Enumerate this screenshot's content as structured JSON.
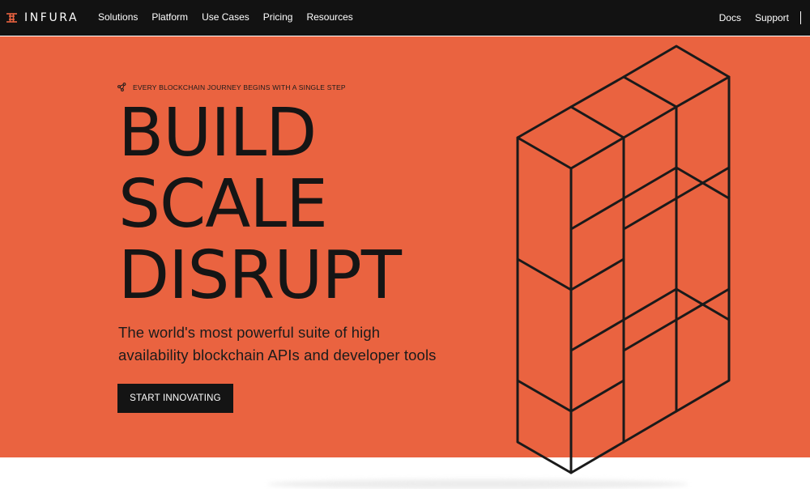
{
  "brand": {
    "name": "INFURA",
    "logo_icon": "infura-logo-icon"
  },
  "nav": {
    "links": [
      "Solutions",
      "Platform",
      "Use Cases",
      "Pricing",
      "Resources"
    ],
    "right_links": [
      "Docs",
      "Support"
    ]
  },
  "hero": {
    "tagline": "EVERY BLOCKCHAIN JOURNEY BEGINS WITH A SINGLE STEP",
    "tagline_icon": "network-nodes-icon",
    "headline": [
      "BUILD",
      "SCALE",
      "DISRUPT"
    ],
    "subtitle_line1": "The world's most powerful suite of high",
    "subtitle_line2": "availability blockchain APIs and developer tools",
    "cta_label": "START INNOVATING",
    "illustration": "isometric-cube-stack"
  },
  "colors": {
    "nav_background": "#121212",
    "hero_background": "#ea6340",
    "text_dark": "#151515",
    "button_background": "#141414",
    "button_text": "#ffffff"
  }
}
